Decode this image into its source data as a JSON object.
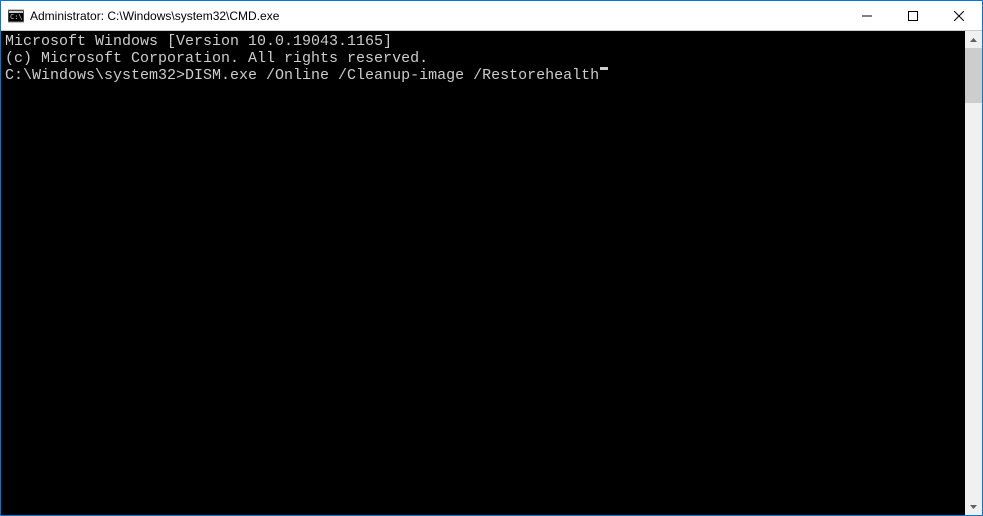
{
  "titlebar": {
    "title": "Administrator: C:\\Windows\\system32\\CMD.exe"
  },
  "terminal": {
    "line1": "Microsoft Windows [Version 10.0.19043.1165]",
    "line2": "(c) Microsoft Corporation. All rights reserved.",
    "blank": "",
    "prompt": "C:\\Windows\\system32>",
    "command": "DISM.exe /Online /Cleanup-image /Restorehealth"
  }
}
